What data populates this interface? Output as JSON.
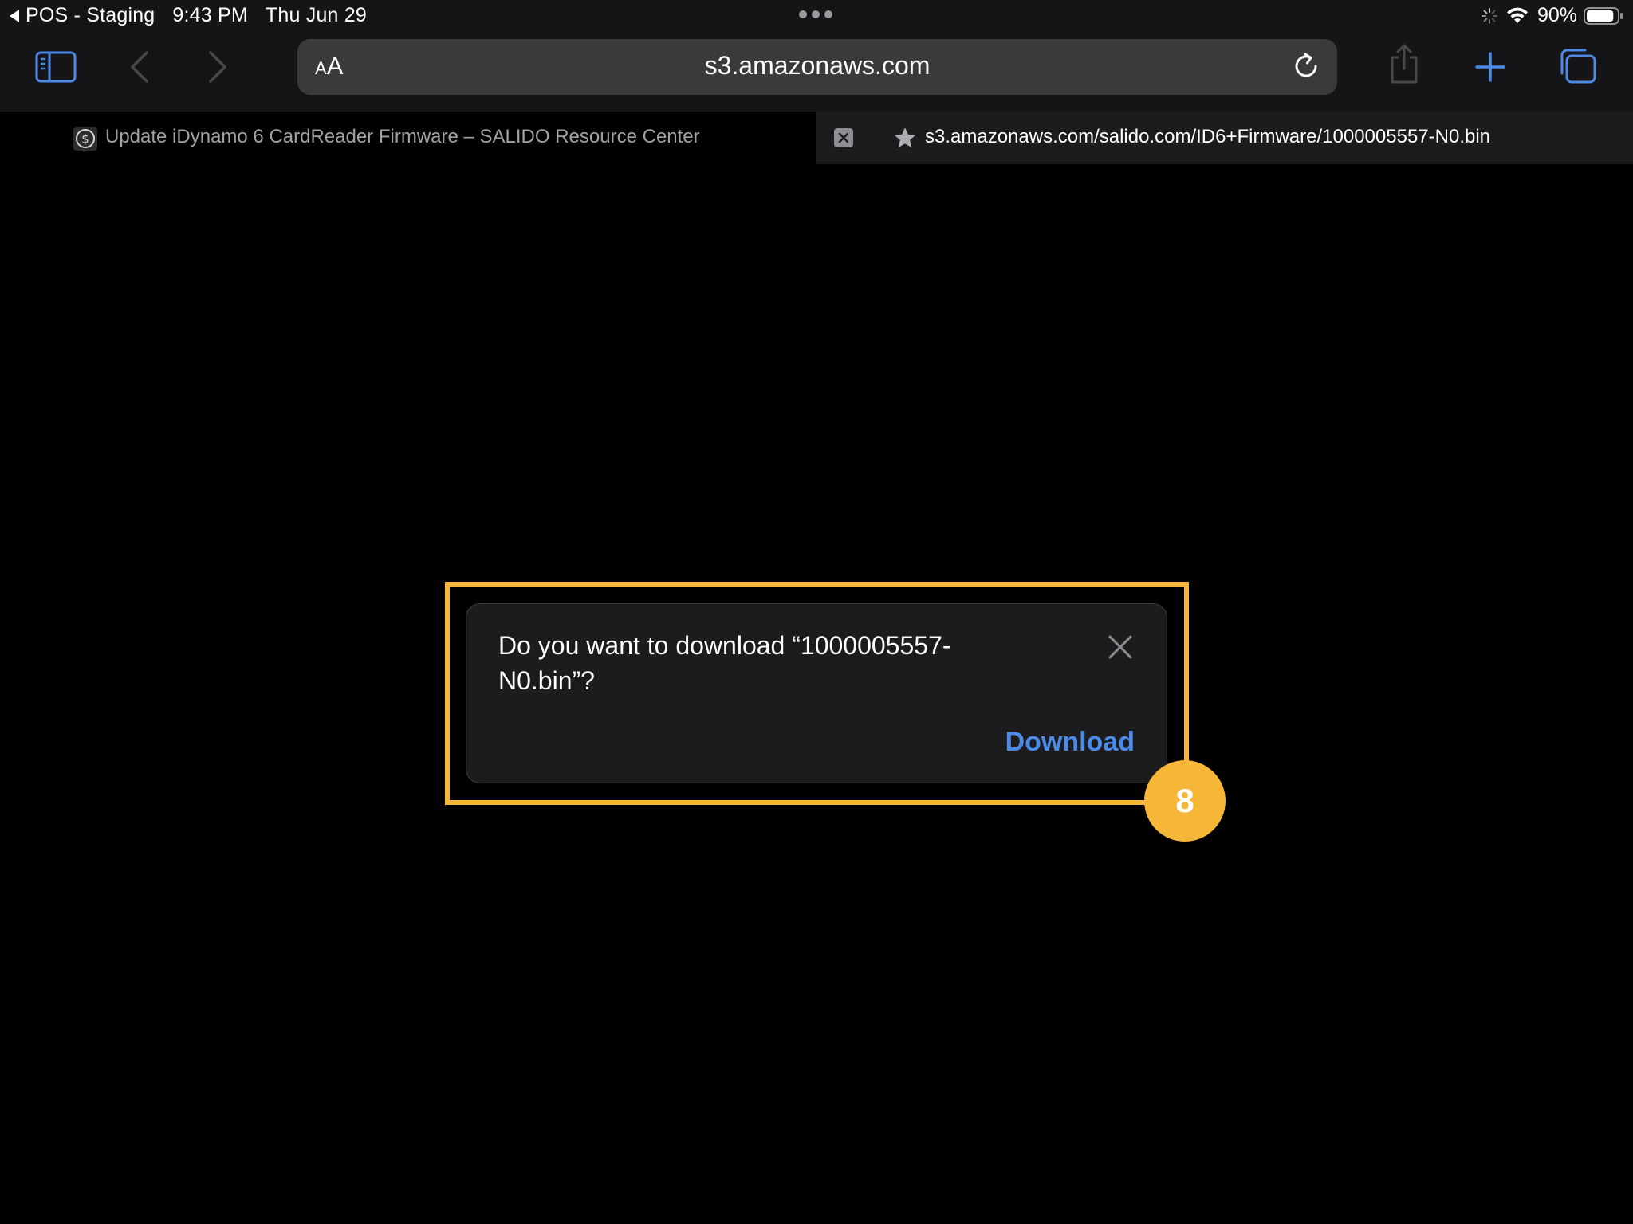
{
  "status_bar": {
    "back_app": "POS - Staging",
    "time": "9:43 PM",
    "date": "Thu Jun 29",
    "battery_percent": "90%",
    "battery_level": 0.9,
    "icons": [
      "back-triangle-icon",
      "multitask-dots-icon",
      "activity-spinner-icon",
      "wifi-icon",
      "battery-icon"
    ]
  },
  "toolbar": {
    "address_text_size_label": "AA",
    "url": "s3.amazonaws.com",
    "icons": [
      "sidebar-icon",
      "back-chevron-icon",
      "forward-chevron-icon",
      "reload-icon",
      "share-icon",
      "new-tab-plus-icon",
      "tabs-overview-icon"
    ],
    "accent_color": "#4c8ae8"
  },
  "tabs": [
    {
      "title": "Update iDynamo 6 CardReader Firmware – SALIDO Resource Center",
      "active": false,
      "icon": "salido-favicon-icon"
    },
    {
      "title": "s3.amazonaws.com/salido.com/ID6+Firmware/1000005557-N0.bin",
      "active": true,
      "icon": "star-icon"
    }
  ],
  "dialog": {
    "message": "Do you want to download “1000005557-N0.bin”?",
    "download_label": "Download",
    "close_icon": "close-icon"
  },
  "annotation": {
    "step_number": "8",
    "highlight_color": "#f6b738"
  }
}
